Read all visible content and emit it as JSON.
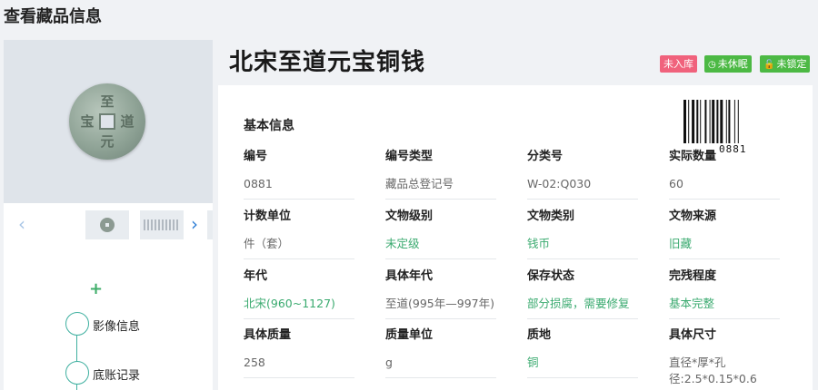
{
  "page": {
    "title": "查看藏品信息"
  },
  "item": {
    "name": "北宋至道元宝铜钱"
  },
  "badges": {
    "storage": "未入库",
    "dormant": "未休眠",
    "locked": "未锁定"
  },
  "colors": {
    "badge_red": "#f0627c",
    "badge_green": "#4cb944",
    "link_green": "#3aaa6f",
    "timeline": "#3fb0a0"
  },
  "icons": {
    "prev": "chevron-left-icon",
    "next": "chevron-right-icon",
    "add": "plus-icon",
    "clock": "clock-icon",
    "lock": "lock-icon"
  },
  "gallery": {
    "main_image_chars": [
      "至",
      "道",
      "元",
      "宝"
    ]
  },
  "timeline": [
    {
      "label": "影像信息"
    },
    {
      "label": "底账记录"
    }
  ],
  "basic_info": {
    "title": "基本信息",
    "barcode_number": "0881",
    "fields": [
      {
        "label": "编号",
        "value": "0881"
      },
      {
        "label": "编号类型",
        "value": "藏品总登记号"
      },
      {
        "label": "分类号",
        "value": "W-02:Q030"
      },
      {
        "label": "实际数量",
        "value": "60"
      },
      {
        "label": "计数单位",
        "value": "件（套）"
      },
      {
        "label": "文物级别",
        "value": "未定级"
      },
      {
        "label": "文物类别",
        "value": "钱币"
      },
      {
        "label": "文物来源",
        "value": "旧藏"
      },
      {
        "label": "年代",
        "value": "北宋(960~1127)"
      },
      {
        "label": "具体年代",
        "value": "至道(995年—997年)"
      },
      {
        "label": "保存状态",
        "value": "部分损腐，需要修复"
      },
      {
        "label": "完残程度",
        "value": "基本完整"
      },
      {
        "label": "具体质量",
        "value": "258"
      },
      {
        "label": "质量单位",
        "value": "g"
      },
      {
        "label": "质地",
        "value": "铜"
      },
      {
        "label": "具体尺寸",
        "value": "直径*厚*孔径:2.5*0.15*0.6"
      }
    ]
  }
}
